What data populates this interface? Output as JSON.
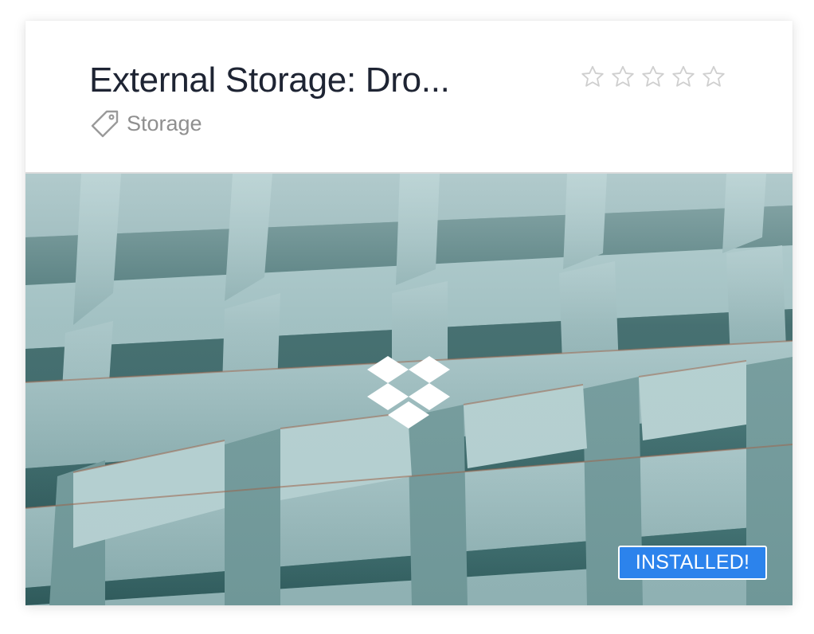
{
  "app": {
    "title": "External Storage: Dro...",
    "category": "Storage",
    "category_icon": "tag-icon",
    "rating_stars": 0,
    "rating_max": 5,
    "status_badge": "INSTALLED!",
    "logo_icon": "dropbox-icon",
    "hero_image": "rusty-teal-metal-grid-compartments"
  },
  "colors": {
    "title": "#1e2433",
    "muted_text": "#8f8f8f",
    "star_outline": "#cfcfcf",
    "badge_background": "#2c83ec",
    "badge_text": "#ffffff"
  }
}
